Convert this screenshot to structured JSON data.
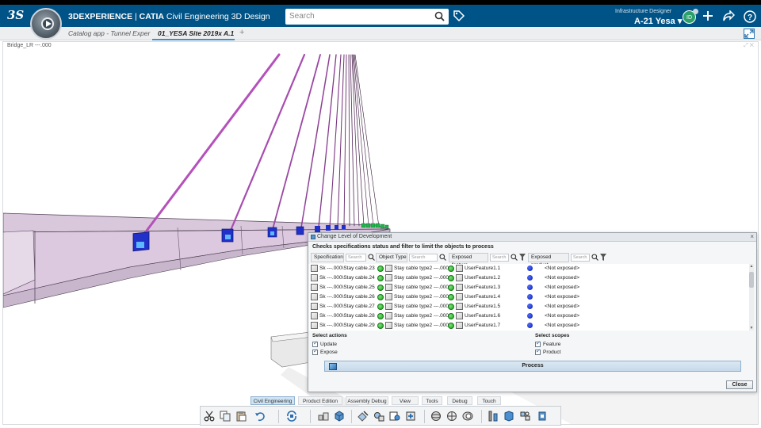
{
  "header": {
    "brand_prefix": "3DEXPERIENCE",
    "brand_app": "CATIA",
    "brand_product": "Civil Engineering 3D Design",
    "search_placeholder": "Search",
    "role": "Infrastructure Designer",
    "context": "A-21 Yesa",
    "avatar_initials": "ID",
    "colors": {
      "bar": "#005386",
      "accent": "#3d8fc7"
    }
  },
  "tabs": [
    {
      "label": "Catalog app - Tunnel Exper",
      "active": false
    },
    {
      "label": "01_YESA Site 2019x A.1",
      "active": true
    }
  ],
  "viewport": {
    "label": "Bridge_LR ---.000"
  },
  "dialog": {
    "title": "Change Level of Development",
    "subtitle": "Checks specifications status and filter to limit the objects to process",
    "filters": [
      {
        "label": "Specification",
        "placeholder": "Search"
      },
      {
        "label": "Object Type",
        "placeholder": "Search"
      },
      {
        "label": "Exposed feature",
        "placeholder": "Search"
      },
      {
        "label": "Exposed product",
        "placeholder": "Search"
      }
    ],
    "rows": [
      {
        "spec": "Sk ---.000\\Stay cable.23",
        "type": "Stay cable type2 ---.000",
        "feature": "UserFeature1.1",
        "product": "<Not exposed>"
      },
      {
        "spec": "Sk ---.000\\Stay cable.24",
        "type": "Stay cable type2 ---.000",
        "feature": "UserFeature1.2",
        "product": "<Not exposed>"
      },
      {
        "spec": "Sk ---.000\\Stay cable.25",
        "type": "Stay cable type2 ---.000",
        "feature": "UserFeature1.3",
        "product": "<Not exposed>"
      },
      {
        "spec": "Sk ---.000\\Stay cable.26",
        "type": "Stay cable type2 ---.000",
        "feature": "UserFeature1.4",
        "product": "<Not exposed>"
      },
      {
        "spec": "Sk ---.000\\Stay cable.27",
        "type": "Stay cable type2 ---.000",
        "feature": "UserFeature1.5",
        "product": "<Not exposed>"
      },
      {
        "spec": "Sk ---.000\\Stay cable.28",
        "type": "Stay cable type2 ---.000",
        "feature": "UserFeature1.6",
        "product": "<Not exposed>"
      },
      {
        "spec": "Sk ---.000\\Stay cable.29",
        "type": "Stay cable type2 ---.000",
        "feature": "UserFeature1.7",
        "product": "<Not exposed>"
      }
    ],
    "select_actions_label": "Select actions",
    "actions": [
      {
        "label": "Update",
        "checked": true
      },
      {
        "label": "Expose",
        "checked": true
      }
    ],
    "select_scopes_label": "Select scopes",
    "scopes": [
      {
        "label": "Feature",
        "checked": true
      },
      {
        "label": "Product",
        "checked": true
      }
    ],
    "process_label": "Process",
    "close_label": "Close"
  },
  "action_bar": {
    "tabs": [
      {
        "label": "Civil Engineering",
        "active": true
      },
      {
        "label": "Product Edition",
        "active": false
      },
      {
        "label": "Assembly Debug",
        "active": false
      },
      {
        "label": "View",
        "active": false
      },
      {
        "label": "Tools",
        "active": false
      },
      {
        "label": "Debug",
        "active": false
      },
      {
        "label": "Touch",
        "active": false
      }
    ],
    "tools": [
      "cut-icon",
      "copy-icon",
      "paste-icon",
      "undo-icon",
      "update-icon",
      "assembly-icon",
      "part-icon",
      "design-icon",
      "template-icon",
      "catalog-icon",
      "instantiate-icon",
      "sphere-icon",
      "shell-icon",
      "tunnel-icon",
      "support-icon",
      "cable-icon",
      "settings-icon"
    ]
  }
}
